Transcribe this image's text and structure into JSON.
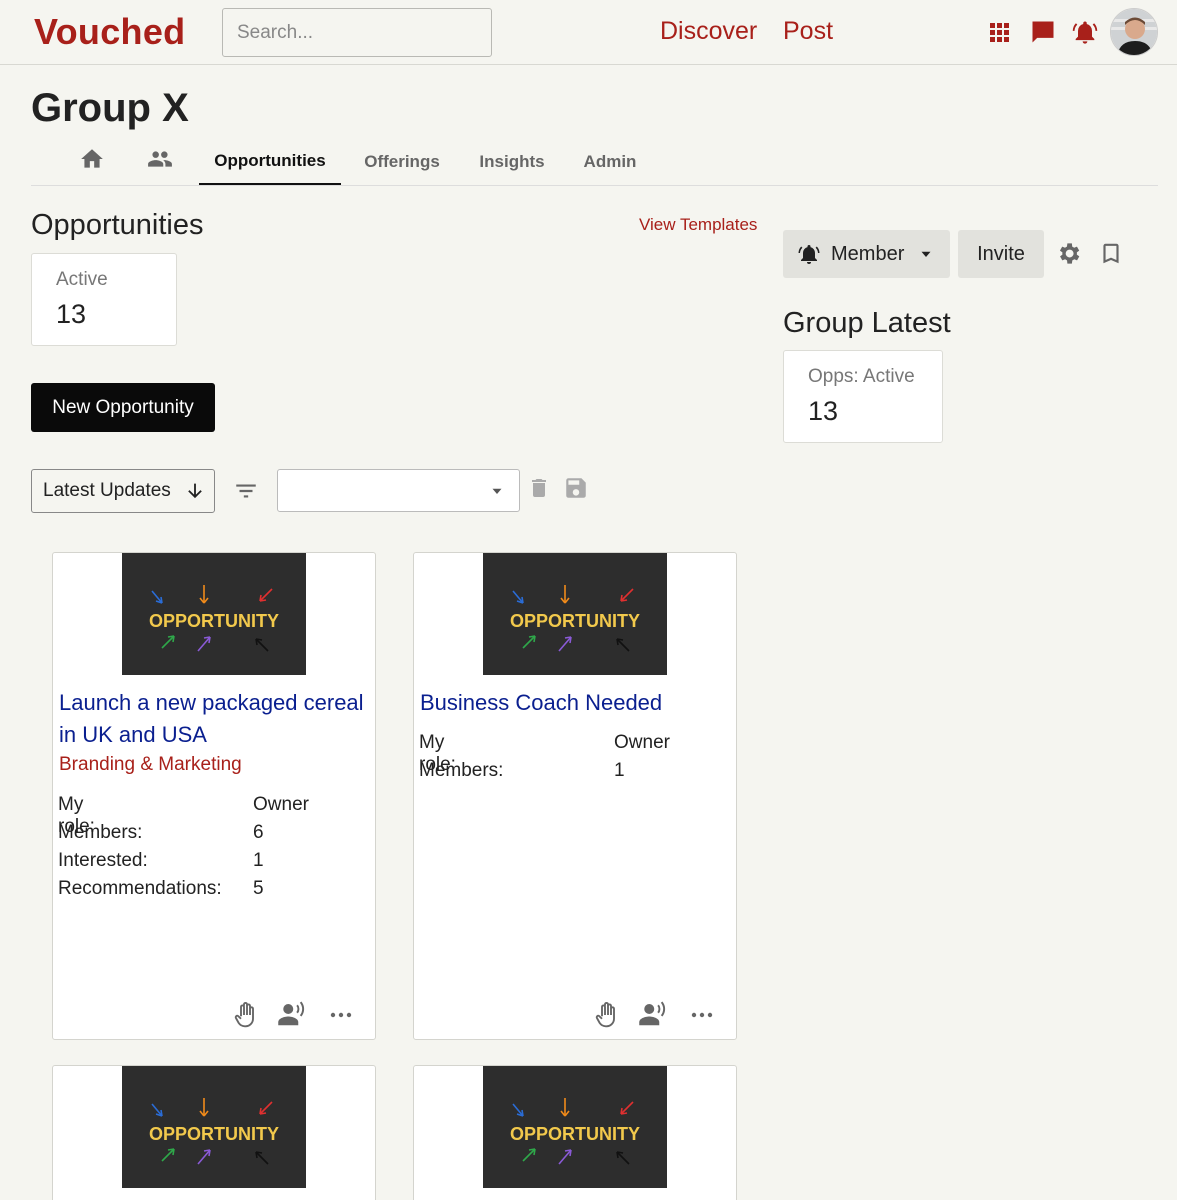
{
  "app": {
    "logo": "Vouched"
  },
  "search": {
    "placeholder": "Search..."
  },
  "nav": {
    "discover": "Discover",
    "post": "Post"
  },
  "brand_color": "#a8201a",
  "link_color": "#0a1f8f",
  "group": {
    "title": "Group X"
  },
  "tabs": [
    {
      "label": "",
      "icon": "home-icon"
    },
    {
      "label": "",
      "icon": "people-icon"
    },
    {
      "label": "Opportunities",
      "active": true
    },
    {
      "label": "Offerings"
    },
    {
      "label": "Insights"
    },
    {
      "label": "Admin"
    }
  ],
  "opportunities": {
    "title": "Opportunities",
    "view_templates": "View Templates",
    "active_label": "Active",
    "active_count": "13",
    "new_button": "New Opportunity",
    "sort_label": "Latest Updates",
    "filter_value": ""
  },
  "sidebar": {
    "member_label": "Member",
    "invite_label": "Invite",
    "latest_title": "Group Latest",
    "latest_label": "Opps: Active",
    "latest_count": "13"
  },
  "cards": [
    {
      "image_text": "OPPORTUNITY",
      "title": "Launch a new packaged cereal in UK and USA",
      "category": "Branding & Marketing",
      "rows": [
        {
          "label": "My role:",
          "value": "Owner"
        },
        {
          "label": "Members:",
          "value": "6"
        },
        {
          "label": "Interested:",
          "value": "1"
        },
        {
          "label": "Recommendations:",
          "value": "5"
        }
      ]
    },
    {
      "image_text": "OPPORTUNITY",
      "title": "Business Coach Needed",
      "category": "",
      "rows": [
        {
          "label": "My role:",
          "value": "Owner"
        },
        {
          "label": "Members:",
          "value": "1"
        }
      ]
    },
    {
      "image_text": "OPPORTUNITY"
    },
    {
      "image_text": "OPPORTUNITY"
    }
  ]
}
